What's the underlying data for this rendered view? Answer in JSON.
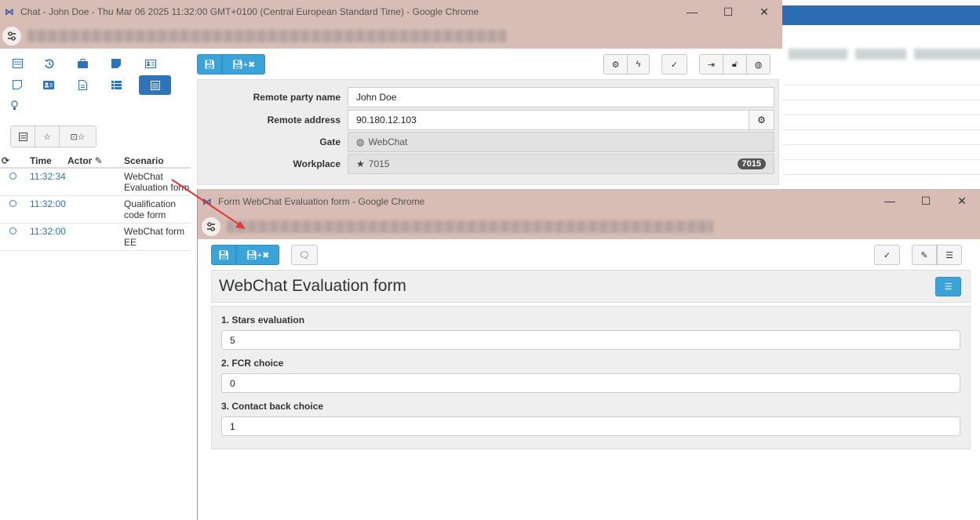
{
  "main_window": {
    "title": "Chat - John Doe - Thu Mar 06 2025 11:32:00 GMT+0100 (Central European Standard Time) - Google Chrome",
    "controls": {
      "minimize": "—",
      "maximize": "☐",
      "close": "✕"
    }
  },
  "conversation": {
    "headers": {
      "time": "Time",
      "actor": "Actor",
      "scenario": "Scenario"
    },
    "rows": [
      {
        "time": "11:32:34",
        "scenario": "WebChat Evaluation form"
      },
      {
        "time": "11:32:00",
        "scenario": "Qualification code form"
      },
      {
        "time": "11:32:00",
        "scenario": "WebChat form EE"
      }
    ]
  },
  "contact_form": {
    "remote_party_name": {
      "label": "Remote party name",
      "value": "John Doe"
    },
    "remote_address": {
      "label": "Remote address",
      "value": "90.180.12.103"
    },
    "gate": {
      "label": "Gate",
      "value": "WebChat"
    },
    "workplace": {
      "label": "Workplace",
      "value": "7015",
      "badge": "7015"
    }
  },
  "popup": {
    "title": "Form WebChat Evaluation form - Google Chrome",
    "form_title": "WebChat Evaluation form",
    "questions": [
      {
        "label": "1. Stars evaluation",
        "value": "5"
      },
      {
        "label": "2. FCR choice",
        "value": "0"
      },
      {
        "label": "3. Contact back choice",
        "value": "1"
      }
    ]
  },
  "colors": {
    "accent": "#3aa3d8",
    "titlebar": "#d7bdb5",
    "nav": "#2f73b8",
    "arrow": "#e0383a"
  }
}
